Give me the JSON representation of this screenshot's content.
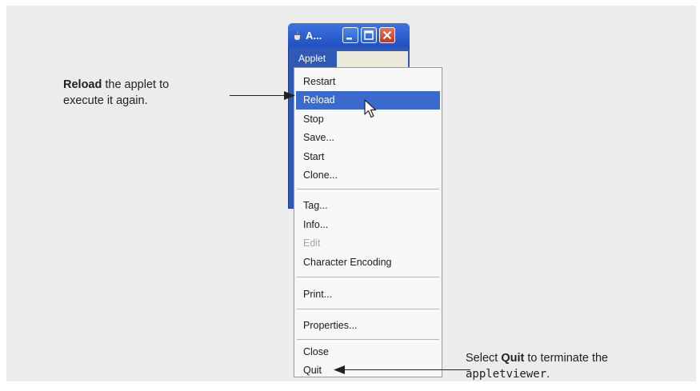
{
  "window": {
    "title": "A...",
    "menubar_label": "Applet"
  },
  "menu": {
    "items": [
      {
        "label": "Restart",
        "state": "normal"
      },
      {
        "label": "Reload",
        "state": "selected"
      },
      {
        "label": "Stop",
        "state": "normal"
      },
      {
        "label": "Save...",
        "state": "normal"
      },
      {
        "label": "Start",
        "state": "normal"
      },
      {
        "label": "Clone...",
        "state": "normal"
      },
      {
        "label": "Tag...",
        "state": "normal"
      },
      {
        "label": "Info...",
        "state": "normal"
      },
      {
        "label": "Edit",
        "state": "disabled"
      },
      {
        "label": "Character Encoding",
        "state": "normal"
      },
      {
        "label": "Print...",
        "state": "normal"
      },
      {
        "label": "Properties...",
        "state": "normal"
      },
      {
        "label": "Close",
        "state": "normal"
      },
      {
        "label": "Quit",
        "state": "normal"
      }
    ]
  },
  "callouts": {
    "reload": {
      "bold": "Reload",
      "line1_rest": " the applet to",
      "line2": "execute it again."
    },
    "quit": {
      "prefix": "Select ",
      "bold": "Quit",
      "suffix": " to terminate the",
      "code": "appletviewer",
      "end": "."
    }
  },
  "colors": {
    "titlebar": "#3f74e0",
    "selection": "#3a6acd",
    "close_button": "#d54a2e",
    "background_panel": "#ececec"
  },
  "icons": {
    "app": "java-cup-icon",
    "minimize": "minimize-icon",
    "maximize": "maximize-icon",
    "close": "close-icon",
    "cursor": "mouse-pointer-icon"
  }
}
